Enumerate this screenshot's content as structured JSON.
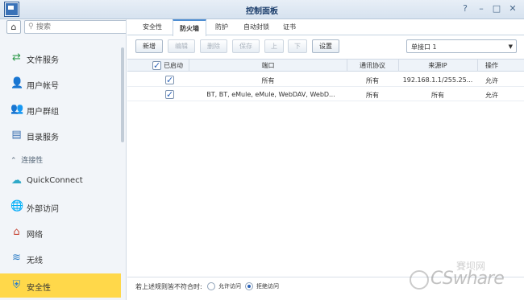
{
  "window": {
    "title": "控制面板",
    "buttons": [
      "?",
      "–",
      "□",
      "✕"
    ]
  },
  "sidebar": {
    "search_placeholder": "搜索",
    "items": [
      {
        "label": "文件服务",
        "icon": "file-services-icon"
      },
      {
        "label": "用户帐号",
        "icon": "user-icon"
      },
      {
        "label": "用户群组",
        "icon": "user-group-icon"
      },
      {
        "label": "目录服务",
        "icon": "directory-icon"
      },
      {
        "label": "QuickConnect",
        "icon": "quickconnect-icon"
      },
      {
        "label": "外部访问",
        "icon": "external-access-icon"
      },
      {
        "label": "网络",
        "icon": "network-icon"
      },
      {
        "label": "无线",
        "icon": "wifi-icon"
      },
      {
        "label": "安全性",
        "icon": "security-icon",
        "active": true
      }
    ],
    "section_label": "连接性"
  },
  "tabs": [
    "安全性",
    "防火墙",
    "防护",
    "自动封锁",
    "证书"
  ],
  "active_tab": "防火墙",
  "toolbar": {
    "buttons": [
      "新增",
      "编辑",
      "删除",
      "保存",
      "上",
      "下",
      "设置"
    ],
    "disabled": [
      "编辑",
      "删除",
      "保存",
      "上",
      "下"
    ],
    "profile_select": "单接口 1"
  },
  "table": {
    "headers": [
      "已启动",
      "端口",
      "通讯协议",
      "来源IP",
      "操作"
    ],
    "rows": [
      {
        "enabled": true,
        "port": "所有",
        "protocol": "所有",
        "source_ip": "192.168.1.1/255.25...",
        "action": "允许"
      },
      {
        "enabled": true,
        "port": "BT, BT, eMule, eMule, WebDAV, WebD...",
        "protocol": "所有",
        "source_ip": "所有",
        "action": "允许"
      }
    ]
  },
  "footer": {
    "label": "若上述规则皆不符合时:",
    "options": [
      "允许访问",
      "拒绝访问"
    ],
    "selected": "拒绝访问"
  },
  "watermark": {
    "text": "CSwhare",
    "top_text": "賽坝网"
  },
  "colors": {
    "accent": "#4f8ed2",
    "active_sidebar": "#ffd84a",
    "titlebar": "#dbe6f2"
  }
}
